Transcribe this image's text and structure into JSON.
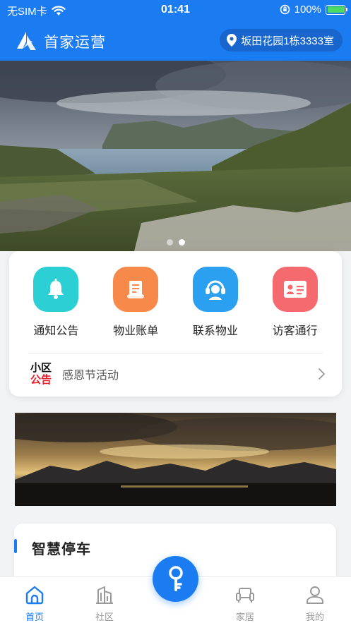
{
  "status_bar": {
    "carrier": "无SIM卡",
    "time": "01:41",
    "battery": "100%",
    "icons": [
      "wifi-icon",
      "rotation-lock-icon",
      "battery-charging-icon"
    ]
  },
  "app_bar": {
    "title": "首家运营",
    "location": "坂田花园1栋3333室",
    "logo": "app-logo"
  },
  "banner": {
    "slide_count": 2,
    "active_index": 1
  },
  "services": [
    {
      "label": "通知公告",
      "icon": "bell-icon",
      "color": "#2ccfd3"
    },
    {
      "label": "物业账单",
      "icon": "scroll-bill-icon",
      "color": "#f7894a"
    },
    {
      "label": "联系物业",
      "icon": "customer-service-icon",
      "color": "#2b9ff0"
    },
    {
      "label": "访客通行",
      "icon": "id-card-icon",
      "color": "#f46a6f"
    }
  ],
  "notice": {
    "badge_line1": "小区",
    "badge_line2": "公告",
    "text": "感恩节活动"
  },
  "parking": {
    "title": "智慧停车"
  },
  "tab_bar": {
    "tabs": [
      {
        "label": "首页",
        "icon": "home-icon",
        "active": true
      },
      {
        "label": "社区",
        "icon": "building-icon",
        "active": false
      },
      {
        "label": "家居",
        "icon": "sofa-icon",
        "active": false
      },
      {
        "label": "我的",
        "icon": "user-icon",
        "active": false
      }
    ],
    "center_action": "key-icon"
  },
  "colors": {
    "brand": "#1b7cf2",
    "notice_red": "#e8202e"
  }
}
